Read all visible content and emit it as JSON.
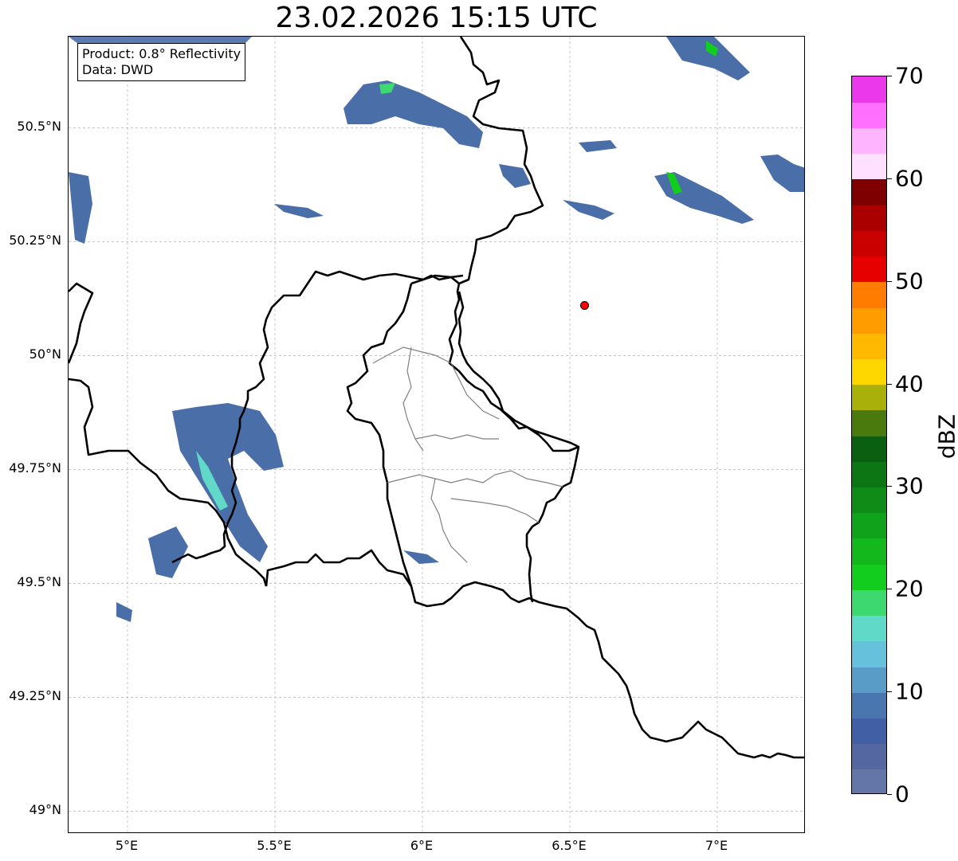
{
  "title": "23.02.2026 15:15 UTC",
  "info": {
    "product": "Product: 0.8° Reflectivity",
    "data_source": "Data: DWD"
  },
  "map": {
    "lon_range": [
      4.8,
      7.3
    ],
    "lat_range": [
      48.95,
      50.7
    ],
    "lat_ticks": [
      {
        "value": 50.5,
        "label": "50.5°N"
      },
      {
        "value": 50.25,
        "label": "50.25°N"
      },
      {
        "value": 50.0,
        "label": "50°N"
      },
      {
        "value": 49.75,
        "label": "49.75°N"
      },
      {
        "value": 49.5,
        "label": "49.5°N"
      },
      {
        "value": 49.25,
        "label": "49.25°N"
      },
      {
        "value": 49.0,
        "label": "49°N"
      }
    ],
    "lon_ticks": [
      {
        "value": 5.0,
        "label": "5°E"
      },
      {
        "value": 5.5,
        "label": "5.5°E"
      },
      {
        "value": 6.0,
        "label": "6°E"
      },
      {
        "value": 6.5,
        "label": "6.5°E"
      },
      {
        "value": 7.0,
        "label": "7°E"
      }
    ],
    "marker": {
      "lon": 6.55,
      "lat": 50.11,
      "color": "#ff0000"
    },
    "colors": {
      "country_border": "#000000",
      "region_border": "#808080",
      "grid": "#b0b0b0"
    }
  },
  "colorbar": {
    "unit": "dBZ",
    "min": 0,
    "max": 70,
    "tick_labels": [
      "0",
      "10",
      "20",
      "30",
      "40",
      "50",
      "60",
      "70"
    ],
    "colors": [
      "#6475a8",
      "#5567a0",
      "#415fa4",
      "#4a76b0",
      "#5a9cc8",
      "#66c1dd",
      "#61d9c8",
      "#3ed870",
      "#12cc1e",
      "#12b81c",
      "#10a21a",
      "#0e8c17",
      "#0c7514",
      "#0a5f10",
      "#4a7a0e",
      "#aab00a",
      "#ffd700",
      "#ffba00",
      "#ff9c00",
      "#ff7c00",
      "#e60000",
      "#c80000",
      "#aa0000",
      "#7f0000",
      "#ffe0ff",
      "#ffb4ff",
      "#ff70ff",
      "#ea38ea"
    ]
  }
}
